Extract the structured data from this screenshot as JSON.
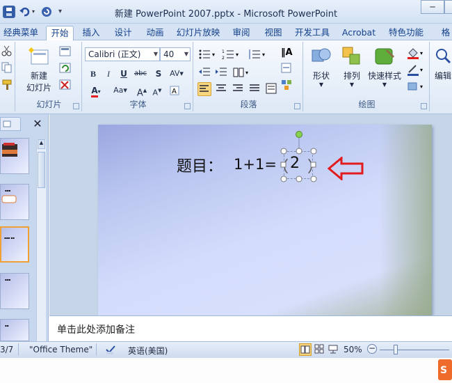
{
  "window": {
    "title": "新建 PowerPoint 2007.pptx - Microsoft PowerPoint"
  },
  "tabs": [
    "经典菜单",
    "开始",
    "插入",
    "设计",
    "动画",
    "幻灯片放映",
    "审阅",
    "视图",
    "开发工具",
    "Acrobat",
    "特色功能",
    "格"
  ],
  "active_tab": "开始",
  "ribbon": {
    "slides_group": {
      "new_slide_label_1": "新建",
      "new_slide_label_2": "幻灯片",
      "label": "幻灯片"
    },
    "font_group": {
      "font_name": "Calibri (正文)",
      "font_size": "40",
      "label": "字体"
    },
    "paragraph_group": {
      "label": "段落"
    },
    "drawing_group": {
      "shapes_label": "形状",
      "arrange_label": "排列",
      "quick_styles_label": "快速样式",
      "label": "绘图"
    },
    "editing_group": {
      "label": "编辑"
    }
  },
  "slide": {
    "question_prefix": "题目：",
    "equation": "1+1=",
    "open_paren": "（",
    "answer": "2",
    "close_paren": "）"
  },
  "notes_placeholder": "单击此处添加备注",
  "status": {
    "slide_counter": "3/7",
    "theme": "\"Office Theme\"",
    "language": "英语(美国)",
    "zoom": "50%"
  },
  "colors": {
    "arrow": "#e21c1c",
    "accent_selected_thumb": "#f0a136"
  },
  "icons": [
    "save-icon",
    "undo-icon",
    "redo-icon",
    "cut-icon",
    "copy-icon",
    "paste-icon",
    "new-slide-icon",
    "layout-icon",
    "reset-icon",
    "delete-icon",
    "bold-icon",
    "italic-icon",
    "underline-icon",
    "strikethrough-icon",
    "shadow-icon",
    "char-spacing-icon",
    "font-color-icon",
    "change-case-icon",
    "grow-font-icon",
    "shrink-font-icon",
    "clear-format-icon",
    "bullets-icon",
    "numbering-icon",
    "line-spacing-icon",
    "text-direction-icon",
    "align-text-icon",
    "convert-smartart-icon",
    "decrease-indent-icon",
    "increase-indent-icon",
    "columns-icon",
    "align-left-icon",
    "center-icon",
    "align-right-icon",
    "justify-icon",
    "distribute-icon",
    "shapes-icon",
    "arrange-icon",
    "quick-styles-icon",
    "shape-fill-icon",
    "shape-outline-icon",
    "shape-effects-icon",
    "editing-icon",
    "red-arrow-icon",
    "normal-view-icon",
    "slide-sorter-icon",
    "slideshow-icon",
    "spell-check-icon"
  ]
}
